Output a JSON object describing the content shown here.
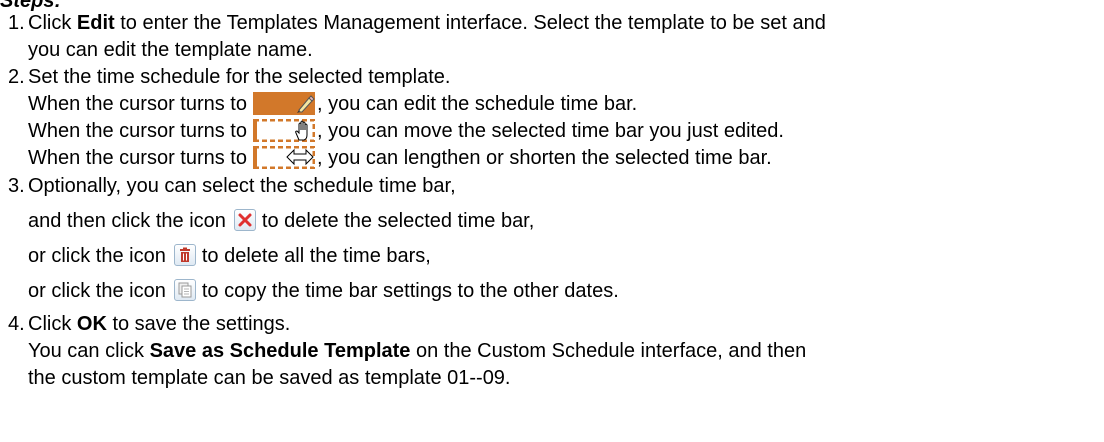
{
  "heading": "Steps:",
  "steps": [
    {
      "num": "1.",
      "text_a_pre": "Click ",
      "text_a_bold": "Edit",
      "text_a_post": " to enter the Templates Management interface. Select the template to be set and",
      "text_b": "you can edit the template name."
    },
    {
      "num": "2.",
      "text": "Set the time schedule for the selected template.",
      "cursor_lines": [
        {
          "before": "When the cursor turns to",
          "after": ", you can edit the schedule time bar.",
          "icon": "pencil-cursor-bar-icon"
        },
        {
          "before": "When the cursor turns to",
          "after": ", you can move the selected time bar you just edited.",
          "icon": "hand-cursor-bar-icon"
        },
        {
          "before": "When the cursor turns to",
          "after": ", you can lengthen or shorten the selected time bar.",
          "icon": "resize-cursor-bar-icon"
        }
      ]
    },
    {
      "num": "3.",
      "text": "Optionally, you can select the schedule time bar,",
      "icon_lines": [
        {
          "before": "and then click the icon",
          "after": "to delete the selected time bar,",
          "icon": "delete-selected-icon"
        },
        {
          "before": "or click the icon",
          "after": "to delete all the time bars,",
          "icon": "delete-all-icon"
        },
        {
          "before": "or click the icon",
          "after": "to copy the time bar settings to the other dates.",
          "icon": "copy-icon"
        }
      ]
    },
    {
      "num": "4.",
      "text_pre": "Click ",
      "text_bold": "OK",
      "text_post": " to save the settings.",
      "note_pre": "You can click ",
      "note_bold": "Save as Schedule Template",
      "note_post": " on the Custom Schedule interface, and then",
      "note_b": "the custom template can be saved as template 01--09."
    }
  ],
  "colors": {
    "bar_fill": "#d2782a",
    "bar_dash": "#d2782a",
    "delete_red": "#e03030",
    "trash_red": "#c0392b"
  }
}
